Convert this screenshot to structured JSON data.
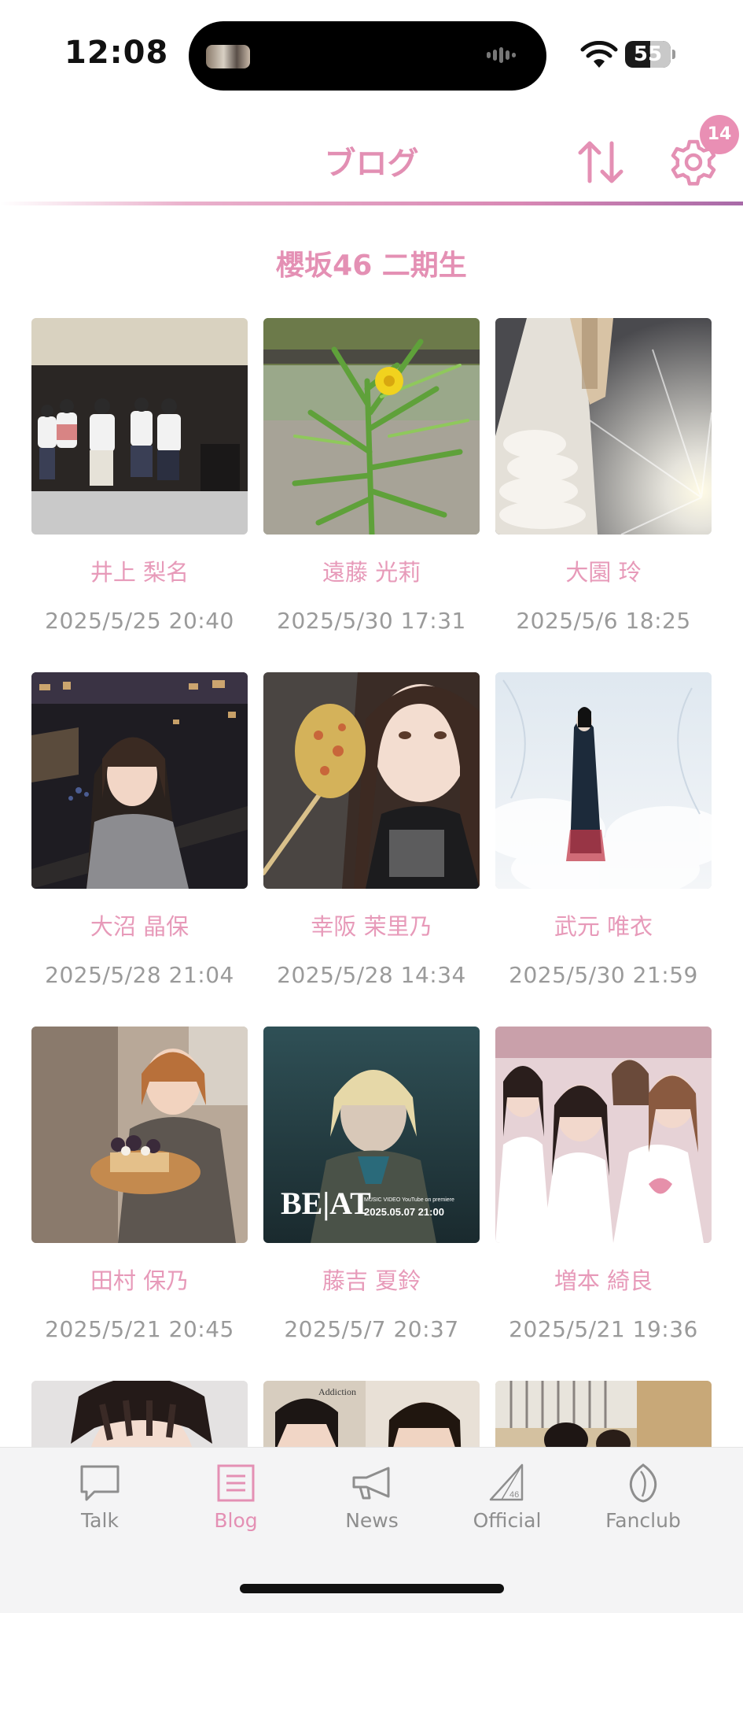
{
  "status_bar": {
    "time": "12:08",
    "battery": "55"
  },
  "header": {
    "title": "ブログ",
    "badge_count": "14"
  },
  "section": {
    "title": "櫻坂46 二期生"
  },
  "posts": [
    {
      "name": "井上 梨名",
      "date": "2025/5/25 20:40"
    },
    {
      "name": "遠藤 光莉",
      "date": "2025/5/30 17:31"
    },
    {
      "name": "大園 玲",
      "date": "2025/5/6 18:25"
    },
    {
      "name": "大沼 晶保",
      "date": "2025/5/28 21:04"
    },
    {
      "name": "幸阪 茉里乃",
      "date": "2025/5/28 14:34"
    },
    {
      "name": "武元 唯衣",
      "date": "2025/5/30 21:59"
    },
    {
      "name": "田村 保乃",
      "date": "2025/5/21 20:45"
    },
    {
      "name": "藤吉 夏鈴",
      "date": "2025/5/7 20:37"
    },
    {
      "name": "増本 綺良",
      "date": "2025/5/21 19:36"
    }
  ],
  "thumb_text": {
    "beat_logo": "BE|AT",
    "beat_caption": "MUSIC VIDEO  YouTube on premiere",
    "beat_datetime": "2025.05.07 21:00",
    "magazine": "Addiction"
  },
  "tabs": [
    {
      "label": "Talk",
      "icon": "chat-bubble-icon"
    },
    {
      "label": "Blog",
      "icon": "document-icon"
    },
    {
      "label": "News",
      "icon": "megaphone-icon"
    },
    {
      "label": "Official",
      "icon": "triangle-46-icon"
    },
    {
      "label": "Fanclub",
      "icon": "leaf-icon"
    }
  ],
  "active_tab": "Blog",
  "colors": {
    "accent_pink": "#e490b4",
    "divider_purple": "#a86aa8",
    "date_gray": "#9a9a9a"
  }
}
